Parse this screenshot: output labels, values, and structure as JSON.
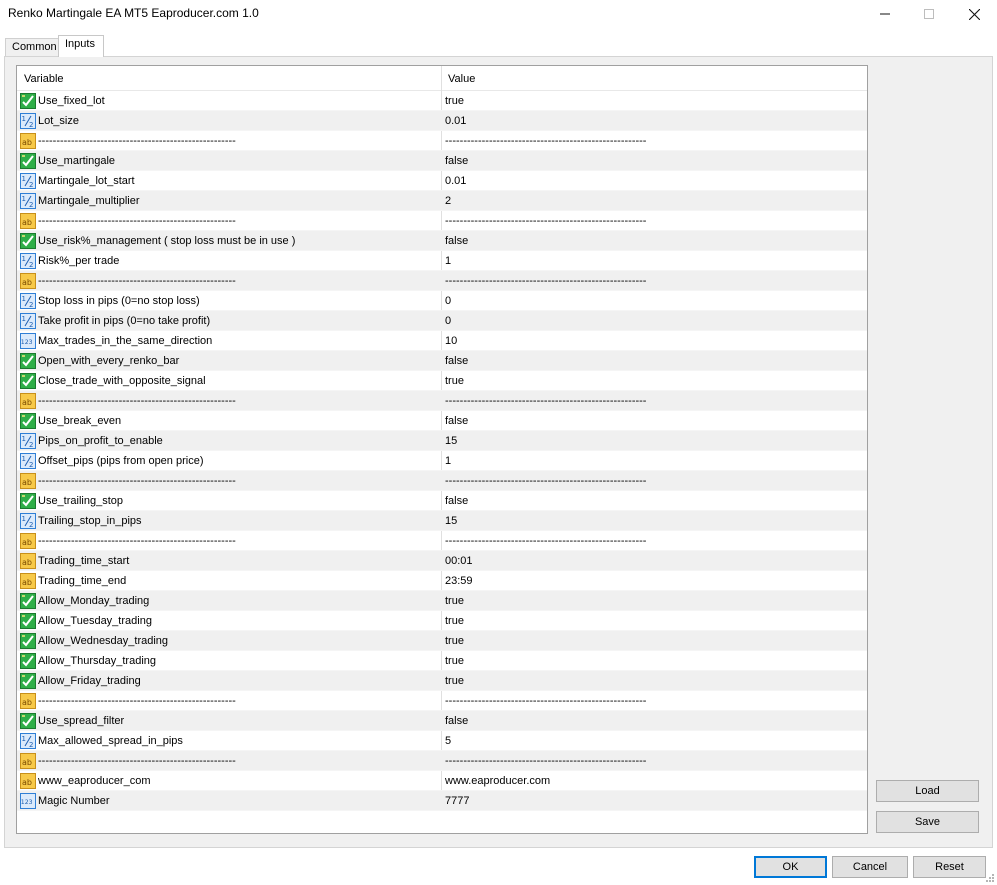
{
  "window": {
    "title": "Renko Martingale EA MT5 Eaproducer.com 1.0"
  },
  "tabs": [
    {
      "label": "Common"
    },
    {
      "label": "Inputs"
    }
  ],
  "grid": {
    "header_variable": "Variable",
    "header_value": "Value",
    "rows": [
      {
        "icon": "bool-icon",
        "variable": "Use_fixed_lot",
        "value": "true"
      },
      {
        "icon": "double-icon",
        "variable": "Lot_size",
        "value": "0.01"
      },
      {
        "icon": "string-icon",
        "variable": "------------------------------------------------------",
        "value": "-------------------------------------------------------"
      },
      {
        "icon": "bool-icon",
        "variable": "Use_martingale",
        "value": "false"
      },
      {
        "icon": "double-icon",
        "variable": "Martingale_lot_start",
        "value": "0.01"
      },
      {
        "icon": "double-icon",
        "variable": "Martingale_multiplier",
        "value": "2"
      },
      {
        "icon": "string-icon",
        "variable": "------------------------------------------------------",
        "value": "-------------------------------------------------------"
      },
      {
        "icon": "bool-icon",
        "variable": "Use_risk%_management ( stop loss must be in use )",
        "value": "false"
      },
      {
        "icon": "double-icon",
        "variable": "Risk%_per trade",
        "value": "1"
      },
      {
        "icon": "string-icon",
        "variable": "------------------------------------------------------",
        "value": "-------------------------------------------------------"
      },
      {
        "icon": "double-icon",
        "variable": "Stop loss in pips (0=no stop loss)",
        "value": "0"
      },
      {
        "icon": "double-icon",
        "variable": "Take profit in pips (0=no take profit)",
        "value": "0"
      },
      {
        "icon": "int-icon",
        "variable": "Max_trades_in_the_same_direction",
        "value": "10"
      },
      {
        "icon": "bool-icon",
        "variable": "Open_with_every_renko_bar",
        "value": "false"
      },
      {
        "icon": "bool-icon",
        "variable": "Close_trade_with_opposite_signal",
        "value": "true"
      },
      {
        "icon": "string-icon",
        "variable": "------------------------------------------------------",
        "value": "-------------------------------------------------------"
      },
      {
        "icon": "bool-icon",
        "variable": "Use_break_even",
        "value": "false"
      },
      {
        "icon": "double-icon",
        "variable": "Pips_on_profit_to_enable",
        "value": "15"
      },
      {
        "icon": "double-icon",
        "variable": "Offset_pips (pips from open price)",
        "value": "1"
      },
      {
        "icon": "string-icon",
        "variable": "------------------------------------------------------",
        "value": "-------------------------------------------------------"
      },
      {
        "icon": "bool-icon",
        "variable": "Use_trailing_stop",
        "value": "false"
      },
      {
        "icon": "double-icon",
        "variable": "Trailing_stop_in_pips",
        "value": "15"
      },
      {
        "icon": "string-icon",
        "variable": "------------------------------------------------------",
        "value": "-------------------------------------------------------"
      },
      {
        "icon": "string-icon",
        "variable": "Trading_time_start",
        "value": "00:01"
      },
      {
        "icon": "string-icon",
        "variable": "Trading_time_end",
        "value": "23:59"
      },
      {
        "icon": "bool-icon",
        "variable": "Allow_Monday_trading",
        "value": "true"
      },
      {
        "icon": "bool-icon",
        "variable": "Allow_Tuesday_trading",
        "value": "true"
      },
      {
        "icon": "bool-icon",
        "variable": "Allow_Wednesday_trading",
        "value": "true"
      },
      {
        "icon": "bool-icon",
        "variable": "Allow_Thursday_trading",
        "value": "true"
      },
      {
        "icon": "bool-icon",
        "variable": "Allow_Friday_trading",
        "value": "true"
      },
      {
        "icon": "string-icon",
        "variable": "------------------------------------------------------",
        "value": "-------------------------------------------------------"
      },
      {
        "icon": "bool-icon",
        "variable": "Use_spread_filter",
        "value": "false"
      },
      {
        "icon": "double-icon",
        "variable": "Max_allowed_spread_in_pips",
        "value": "5"
      },
      {
        "icon": "string-icon",
        "variable": "------------------------------------------------------",
        "value": "-------------------------------------------------------"
      },
      {
        "icon": "string-icon",
        "variable": "www_eaproducer_com",
        "value": "www.eaproducer.com"
      },
      {
        "icon": "int-icon",
        "variable": "Magic Number",
        "value": "7777"
      }
    ]
  },
  "buttons": {
    "load": "Load",
    "save": "Save",
    "ok": "OK",
    "cancel": "Cancel",
    "reset": "Reset"
  },
  "colors": {
    "bool_icon": "#22a03a",
    "double_icon": "#2f7fd6",
    "string_icon": "#e8a820",
    "accent": "#0078d7"
  }
}
